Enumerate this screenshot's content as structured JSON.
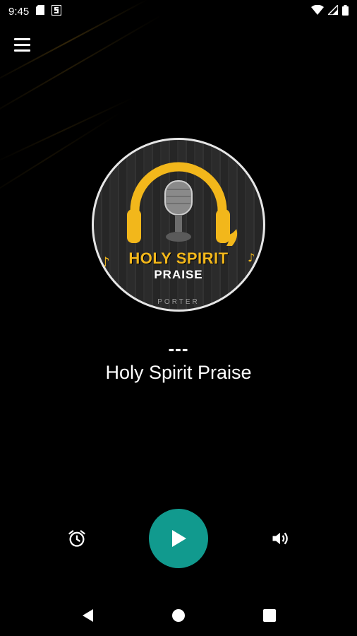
{
  "status_bar": {
    "time": "9:45",
    "left_icons": [
      "sd-card-icon",
      "s-notification-icon"
    ],
    "right_icons": [
      "wifi-icon",
      "signal-icon",
      "battery-icon"
    ]
  },
  "menu": {
    "icon": "hamburger-menu-icon"
  },
  "logo": {
    "title": "HOLY SPIRIT",
    "subtitle": "PRAISE",
    "tagline": "PORTER",
    "colors": {
      "gold": "#f2b71b",
      "ring": "#e6e6e6"
    }
  },
  "now_playing": {
    "track": "---",
    "station": "Holy Spirit Praise"
  },
  "controls": {
    "alarm_icon": "alarm-clock-icon",
    "play_icon": "play-icon",
    "volume_icon": "volume-icon",
    "play_color": "#119a8e"
  },
  "nav_bar": {
    "icons": [
      "back-icon",
      "home-icon",
      "recents-icon"
    ]
  }
}
